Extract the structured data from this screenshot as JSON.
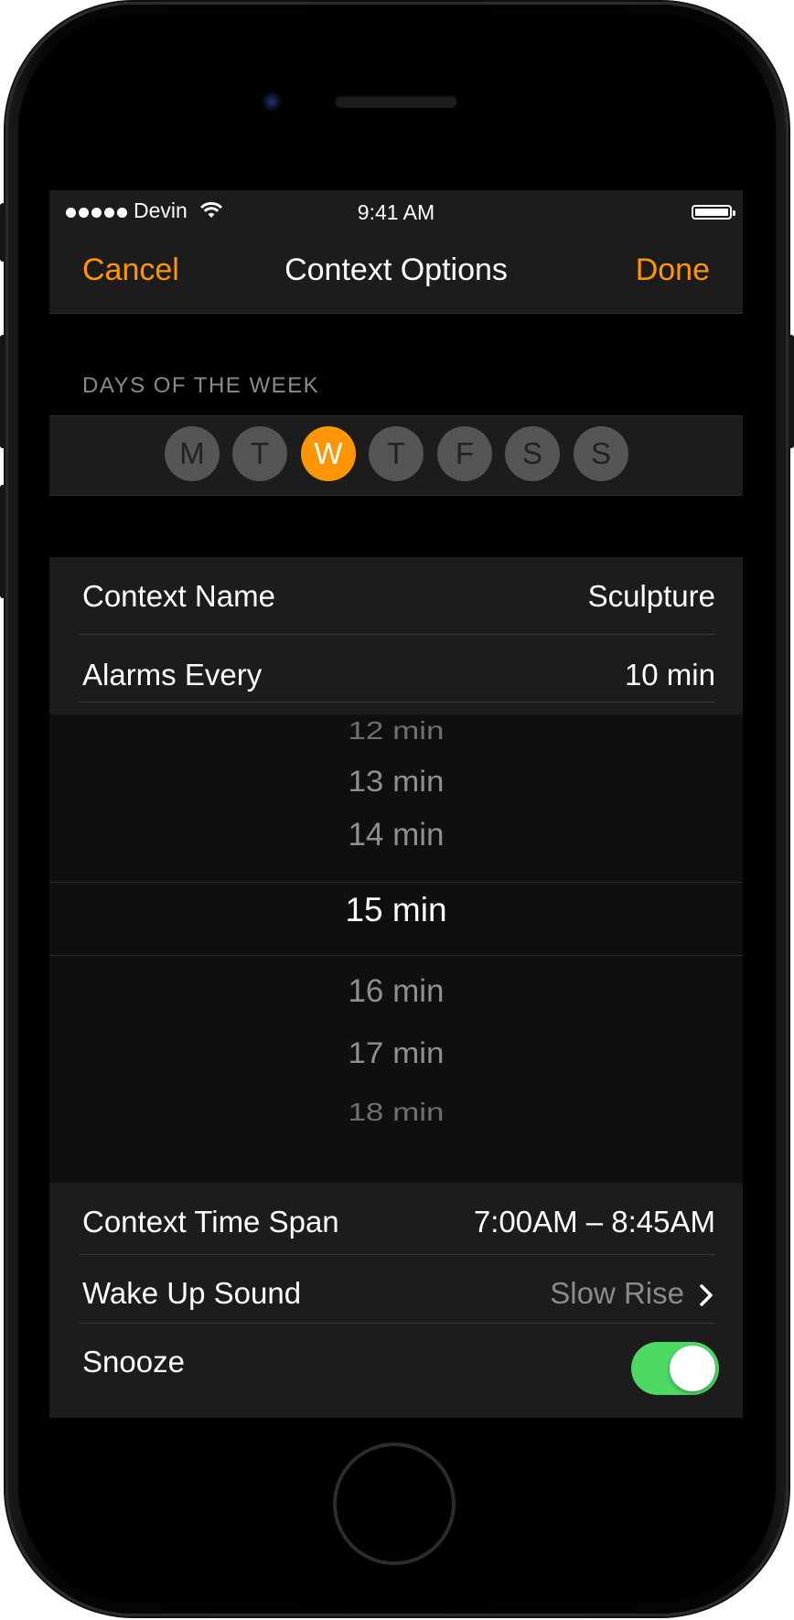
{
  "status_bar": {
    "carrier": "Devin",
    "time": "9:41 AM"
  },
  "nav": {
    "cancel_label": "Cancel",
    "title": "Context Options",
    "done_label": "Done"
  },
  "days_section": {
    "header": "DAYS OF THE WEEK",
    "days": [
      {
        "letter": "M",
        "selected": false
      },
      {
        "letter": "T",
        "selected": false
      },
      {
        "letter": "W",
        "selected": true
      },
      {
        "letter": "T",
        "selected": false
      },
      {
        "letter": "F",
        "selected": false
      },
      {
        "letter": "S",
        "selected": false
      },
      {
        "letter": "S",
        "selected": false
      }
    ]
  },
  "settings": {
    "context_name": {
      "label": "Context Name",
      "value": "Sculpture"
    },
    "alarms_every": {
      "label": "Alarms Every",
      "value": "10 min"
    },
    "context_time_span": {
      "label": "Context Time Span",
      "value": "7:00AM – 8:45AM"
    },
    "wake_up_sound": {
      "label": "Wake Up Sound",
      "value": "Slow Rise"
    },
    "snooze": {
      "label": "Snooze",
      "enabled": true
    }
  },
  "picker": {
    "options": [
      "12 min",
      "13 min",
      "14 min",
      "15 min",
      "16 min",
      "17 min",
      "18 min"
    ],
    "selected": "15 min"
  },
  "colors": {
    "accent": "#ff9500",
    "toggle_on": "#4cd964",
    "background": "#000000",
    "cell": "#1c1c1c"
  },
  "icons": [
    "wifi-icon",
    "battery-icon",
    "chevron-right-icon",
    "signal-dots-icon"
  ]
}
